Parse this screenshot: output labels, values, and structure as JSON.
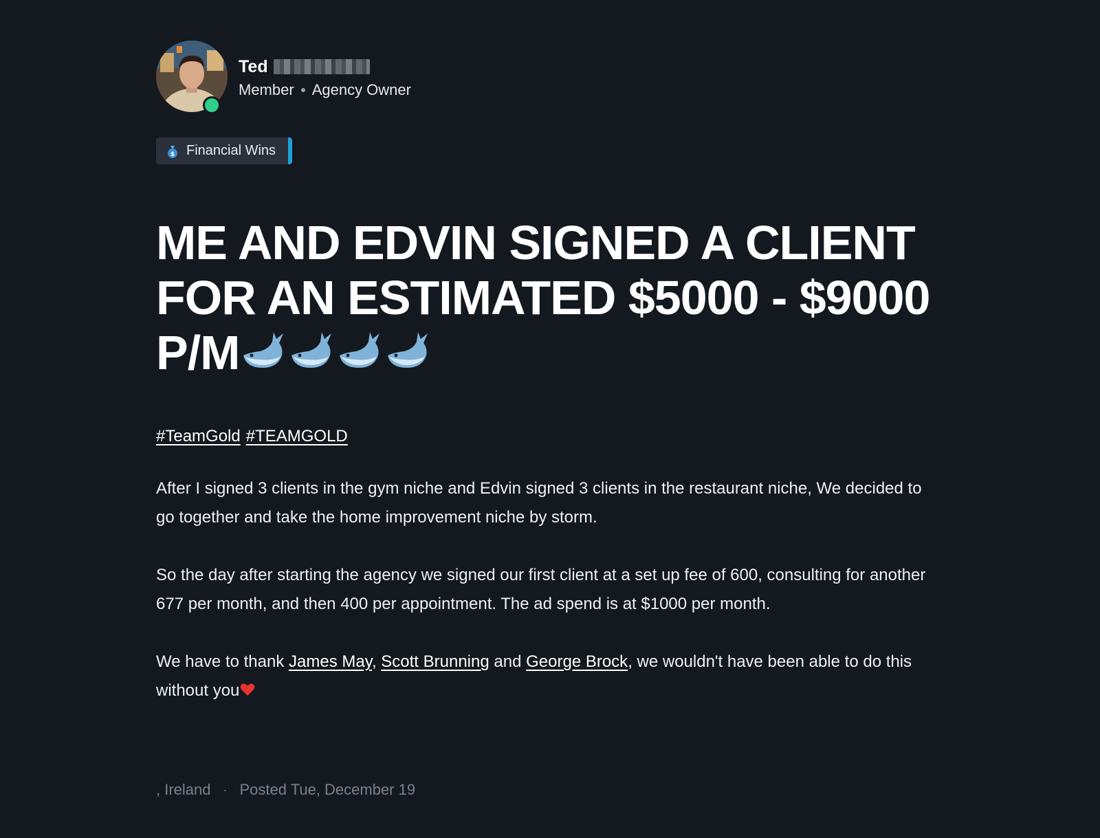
{
  "author": {
    "name": "Ted",
    "role": "Member",
    "title": "Agency Owner",
    "online": true
  },
  "category": {
    "label": "Financial Wins",
    "icon": "money-bag-icon",
    "accent": "#1ea1d9"
  },
  "post": {
    "title": "ME AND EDVIN SIGNED A CLIENT FOR AN ESTIMATED $5000 - $9000 P/M",
    "title_emoji": "whale-icon",
    "title_emoji_count": 4,
    "hashtags": [
      "#TeamGold",
      "#TEAMGOLD"
    ],
    "paragraph1": "After I signed 3 clients in the gym niche and Edvin signed 3 clients in the restaurant niche, We decided to go together and take the home improvement niche by storm.",
    "paragraph2": "So the day after starting the agency we signed our first client at a set up fee of 600, consulting for another 677 per month, and then 400 per appointment. The ad spend is at $1000 per month.",
    "paragraph3": {
      "prefix": "We have to thank ",
      "mentions": [
        "James May",
        "Scott Brunning",
        "George Brock"
      ],
      "sep1": ", ",
      "sep2": " and ",
      "suffix": ", we wouldn't have been able to do this without you",
      "end_emoji": "heart-icon"
    }
  },
  "footer": {
    "location": ", Ireland",
    "separator": "·",
    "posted": "Posted Tue, December 19"
  },
  "colors": {
    "background": "#14181f",
    "online": "#2fcf8a",
    "badge_bg": "#2a313b",
    "muted": "#7b828c"
  }
}
